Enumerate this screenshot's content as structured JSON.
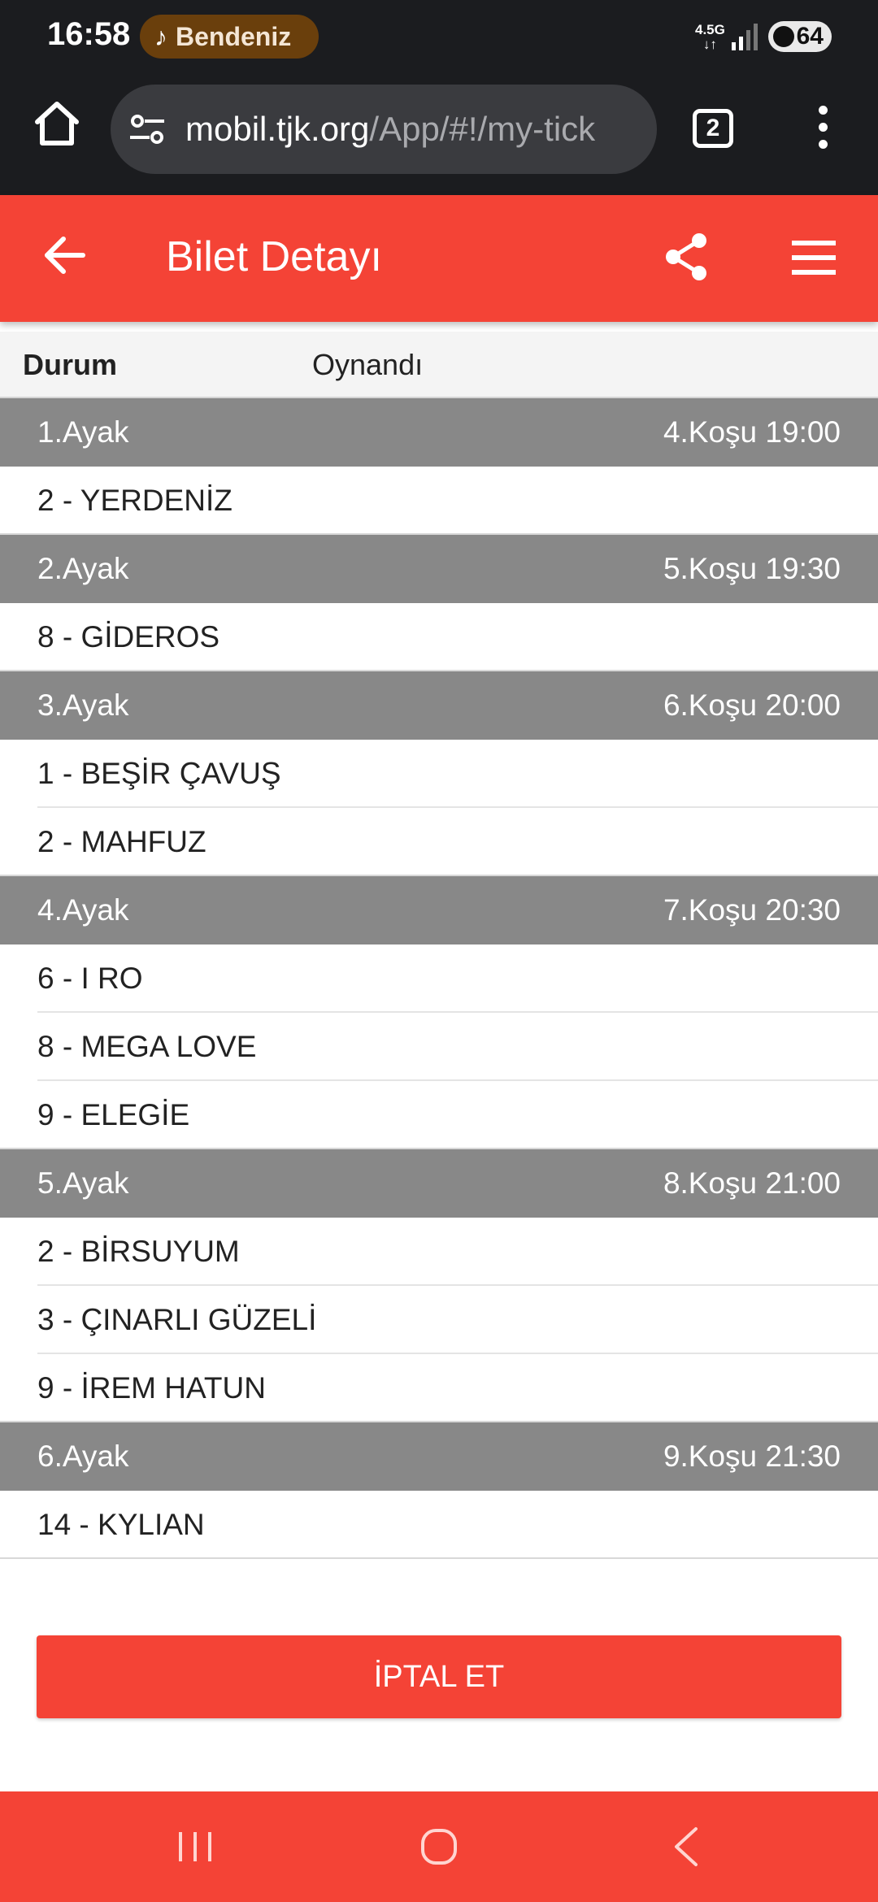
{
  "status_bar": {
    "time": "16:58",
    "media_chip": "Bendeniz",
    "network": "4.5G",
    "battery": "64"
  },
  "browser": {
    "url_host": "mobil.tjk.org",
    "url_path": "/App/#!/my-tick",
    "tab_count": "2"
  },
  "header": {
    "title": "Bilet Detayı"
  },
  "status": {
    "label": "Durum",
    "value": "Oynandı"
  },
  "legs": [
    {
      "leg": "1.Ayak",
      "race": "4.Koşu 19:00",
      "horses": [
        "2 - YERDENİZ"
      ]
    },
    {
      "leg": "2.Ayak",
      "race": "5.Koşu 19:30",
      "horses": [
        "8 - GİDEROS"
      ]
    },
    {
      "leg": "3.Ayak",
      "race": "6.Koşu 20:00",
      "horses": [
        "1 - BEŞİR ÇAVUŞ",
        "2 - MAHFUZ"
      ]
    },
    {
      "leg": "4.Ayak",
      "race": "7.Koşu 20:30",
      "horses": [
        "6 - I RO",
        "8 - MEGA LOVE",
        "9 - ELEGİE"
      ]
    },
    {
      "leg": "5.Ayak",
      "race": "8.Koşu 21:00",
      "horses": [
        "2 - BİRSUYUM",
        "3 - ÇINARLI GÜZELİ",
        "9 - İREM HATUN"
      ]
    },
    {
      "leg": "6.Ayak",
      "race": "9.Koşu 21:30",
      "horses": [
        "14 - KYLIAN"
      ]
    }
  ],
  "actions": {
    "cancel_label": "İPTAL ET"
  },
  "colors": {
    "accent": "#f44336",
    "leg_header": "#888888",
    "chrome": "#1b1c1f"
  }
}
